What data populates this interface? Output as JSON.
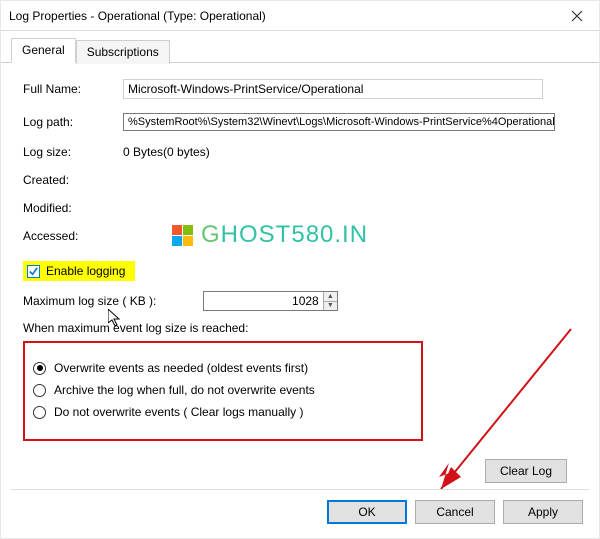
{
  "dialog": {
    "title": "Log Properties - Operational (Type: Operational)"
  },
  "tabs": {
    "general": "General",
    "subscriptions": "Subscriptions"
  },
  "fields": {
    "full_name_label": "Full Name:",
    "full_name_value": "Microsoft-Windows-PrintService/Operational",
    "log_path_label": "Log path:",
    "log_path_value": "%SystemRoot%\\System32\\Winevt\\Logs\\Microsoft-Windows-PrintService%4Operational",
    "log_size_label": "Log size:",
    "log_size_value": "0 Bytes(0 bytes)",
    "created_label": "Created:",
    "created_value": "",
    "modified_label": "Modified:",
    "modified_value": "",
    "accessed_label": "Accessed:",
    "accessed_value": ""
  },
  "enable_logging": {
    "label": "Enable logging",
    "checked": true
  },
  "max_log": {
    "label": "Maximum log size ( KB ):",
    "value": "1028"
  },
  "reached_label": "When maximum event log size is reached:",
  "radios": {
    "overwrite": "Overwrite events as needed (oldest events first)",
    "archive": "Archive the log when full, do not overwrite events",
    "noover": "Do not overwrite events ( Clear logs manually )"
  },
  "buttons": {
    "clear_log": "Clear Log",
    "ok": "OK",
    "cancel": "Cancel",
    "apply": "Apply"
  },
  "watermark": {
    "text": "HOST580.IN",
    "g": "G"
  }
}
